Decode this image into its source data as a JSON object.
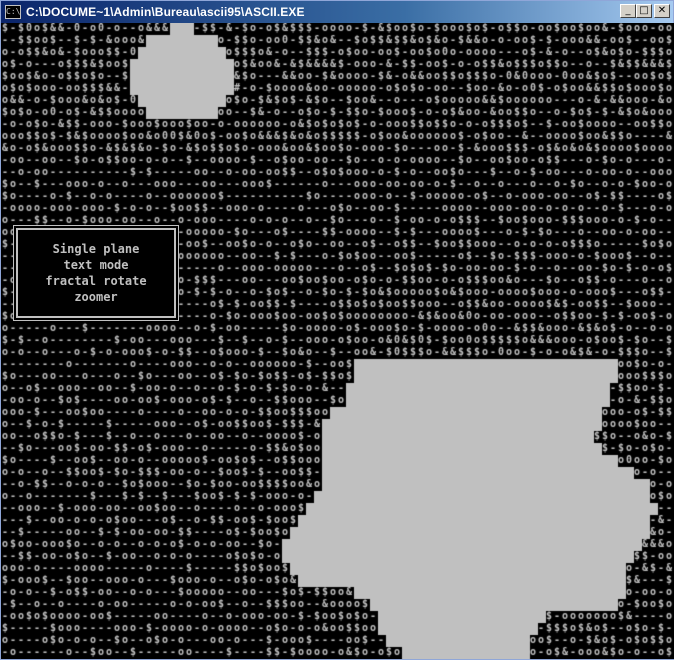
{
  "window": {
    "title": "C:\\DOCUME~1\\Admin\\Bureau\\ascii95\\ASCII.EXE",
    "icon_label": "C:\\",
    "buttons": {
      "minimize": "_",
      "maximize": "□",
      "close": "✕"
    }
  },
  "console": {
    "text_color": "#c0c0c0",
    "background": "#000000",
    "info_box": {
      "lines": [
        "Single plane",
        "text mode",
        "fractal rotate",
        "zoomer"
      ]
    }
  },
  "colors": {
    "title_active_start": "#0a246a",
    "title_active_end": "#a6caf0",
    "fractal_fill": "#c0c0c0"
  }
}
